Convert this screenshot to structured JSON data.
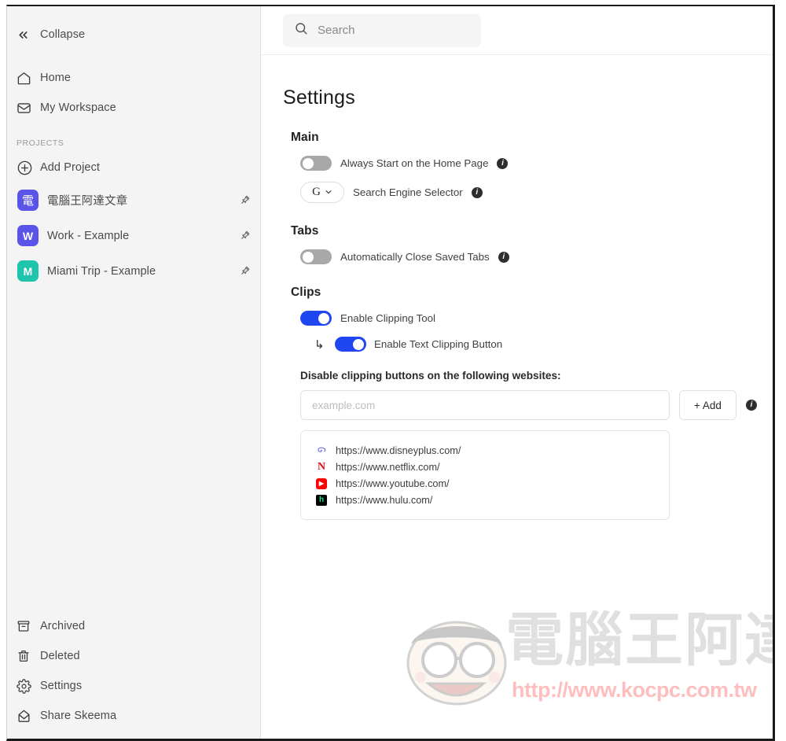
{
  "sidebar": {
    "collapse": {
      "label": "Collapse",
      "icon": "chevrons-left-icon"
    },
    "nav": [
      {
        "label": "Home",
        "icon": "home-icon"
      },
      {
        "label": "My Workspace",
        "icon": "inbox-icon"
      }
    ],
    "projects_header": "PROJECTS",
    "add_project": {
      "label": "Add Project",
      "icon": "plus-circle-icon"
    },
    "projects": [
      {
        "label": "電腦王阿達文章",
        "badge": "電",
        "color": "#5a54e8",
        "pinned": true
      },
      {
        "label": "Work - Example",
        "badge": "W",
        "color": "#5a54e8",
        "pinned": true
      },
      {
        "label": "Miami Trip - Example",
        "badge": "M",
        "color": "#1fc4ac",
        "pinned": true
      }
    ],
    "bottom": [
      {
        "label": "Archived",
        "icon": "archive-icon"
      },
      {
        "label": "Deleted",
        "icon": "trash-icon"
      },
      {
        "label": "Settings",
        "icon": "gear-icon"
      },
      {
        "label": "Share Skeema",
        "icon": "envelope-icon"
      }
    ]
  },
  "topbar": {
    "search": {
      "placeholder": "Search",
      "value": "",
      "icon": "search-icon"
    }
  },
  "settings": {
    "title": "Settings",
    "sections": [
      {
        "title": "Main",
        "options": [
          {
            "label": "Always Start on the Home Page",
            "type": "toggle",
            "on": false,
            "info": true
          },
          {
            "label": "Search Engine Selector",
            "type": "select",
            "value": "G",
            "info": true
          }
        ]
      },
      {
        "title": "Tabs",
        "options": [
          {
            "label": "Automatically Close Saved Tabs",
            "type": "toggle",
            "on": false,
            "info": true
          }
        ]
      },
      {
        "title": "Clips",
        "options": [
          {
            "label": "Enable Clipping Tool",
            "type": "toggle",
            "on": true,
            "info": false
          },
          {
            "label": "Enable Text Clipping Button",
            "type": "toggle",
            "on": true,
            "info": false,
            "nested": true
          }
        ]
      }
    ],
    "disable_label": "Disable clipping buttons on the following websites:",
    "website_input": {
      "placeholder": "example.com",
      "value": ""
    },
    "add_button": "+ Add",
    "add_info": true,
    "sites": [
      {
        "url": "https://www.disneyplus.com/",
        "favicon": "disneyplus-icon"
      },
      {
        "url": "https://www.netflix.com/",
        "favicon": "netflix-icon"
      },
      {
        "url": "https://www.youtube.com/",
        "favicon": "youtube-icon"
      },
      {
        "url": "https://www.hulu.com/",
        "favicon": "hulu-icon"
      }
    ]
  },
  "watermark": {
    "text": "電腦王阿達",
    "url": "http://www.kocpc.com.tw"
  },
  "colors": {
    "accent_blue": "#1f46f0",
    "toggle_off": "#a8a8a8",
    "sidebar_bg": "#f4f4f4",
    "watermark_red": "#ff2a2a"
  }
}
